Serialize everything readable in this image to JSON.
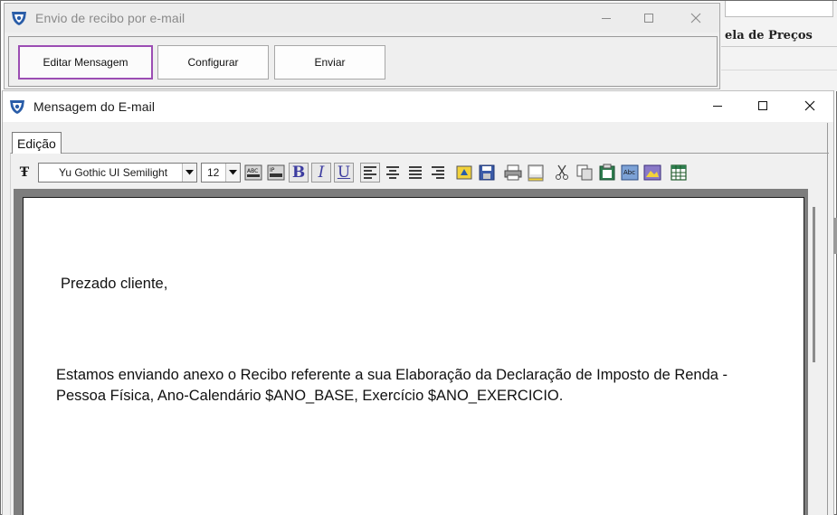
{
  "background_app": {
    "header_label": "ela de Preços"
  },
  "envio_window": {
    "title": "Envio de recibo por e-mail",
    "buttons": {
      "editar": "Editar Mensagem",
      "configurar": "Configurar",
      "enviar": "Enviar"
    }
  },
  "mensagem_window": {
    "title": "Mensagem do E-mail",
    "tab_label": "Edição",
    "toolbar": {
      "font_name": "Yu Gothic UI Semilight",
      "font_size": "12",
      "bold_glyph": "B",
      "italic_glyph": "I",
      "underline_glyph": "U"
    },
    "editor": {
      "greeting": "Prezado cliente,",
      "body_line1": "Estamos enviando anexo o Recibo referente a sua Elaboração da Declaração de Imposto de Renda -",
      "body_line2": "Pessoa Física, Ano-Calendário $ANO_BASE, Exercício $ANO_EXERCICIO."
    }
  },
  "icons": {
    "app_icon": "shield-logo-icon",
    "minimize": "minimize-icon",
    "maximize": "maximize-icon",
    "close": "close-icon"
  },
  "colors": {
    "active_button_border": "#9b4db3",
    "window_background": "#f0f0f0",
    "editor_frame": "#7d7d7d"
  }
}
